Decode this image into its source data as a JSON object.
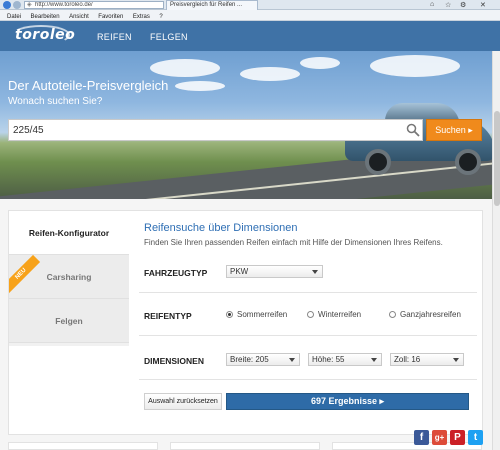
{
  "browser": {
    "url": "http://www.toroleo.de/",
    "tab_title": "Preisvergleich für Reifen ...",
    "menu": [
      "Datei",
      "Bearbeiten",
      "Ansicht",
      "Favoriten",
      "Extras",
      "?"
    ]
  },
  "header": {
    "logo": "toroleo",
    "nav": [
      "REIFEN",
      "FELGEN"
    ],
    "color": "#3f72a6"
  },
  "hero": {
    "title": "Der Autoteile-Preisvergleich",
    "subtitle": "Wonach suchen Sie?",
    "search_value": "225/45",
    "search_button": "Suchen",
    "accent": "#f08a1c"
  },
  "sidebar": {
    "items": [
      {
        "label": "Reifen-Konfigurator",
        "active": true
      },
      {
        "label": "Carsharing",
        "badge": "NEU"
      },
      {
        "label": "Felgen"
      }
    ]
  },
  "form": {
    "title": "Reifensuche über Dimensionen",
    "description": "Finden Sie Ihren passenden Reifen einfach mit Hilfe der Dimensionen Ihres Reifens.",
    "vehicle_label": "FAHRZEUGTYP",
    "vehicle_value": "PKW",
    "tyre_label": "REIFENTYP",
    "tyre_options": [
      "Sommerreifen",
      "Winterreifen",
      "Ganzjahresreifen"
    ],
    "tyre_selected": "Sommerreifen",
    "dimensions_label": "DIMENSIONEN",
    "width": "Breite: 205",
    "height": "Höhe: 55",
    "rim": "Zoll: 16",
    "reset_button": "Auswahl zurücksetzen",
    "results_button": "697 Ergebnisse ▸",
    "title_color": "#2f6fb4"
  },
  "social": [
    {
      "icon": "facebook-icon",
      "glyph": "f",
      "color": "#3b5998"
    },
    {
      "icon": "google-plus-icon",
      "glyph": "g+",
      "color": "#dd4b39"
    },
    {
      "icon": "pinterest-icon",
      "glyph": "P",
      "color": "#cb2027"
    },
    {
      "icon": "twitter-icon",
      "glyph": "t",
      "color": "#1da1f2"
    }
  ]
}
